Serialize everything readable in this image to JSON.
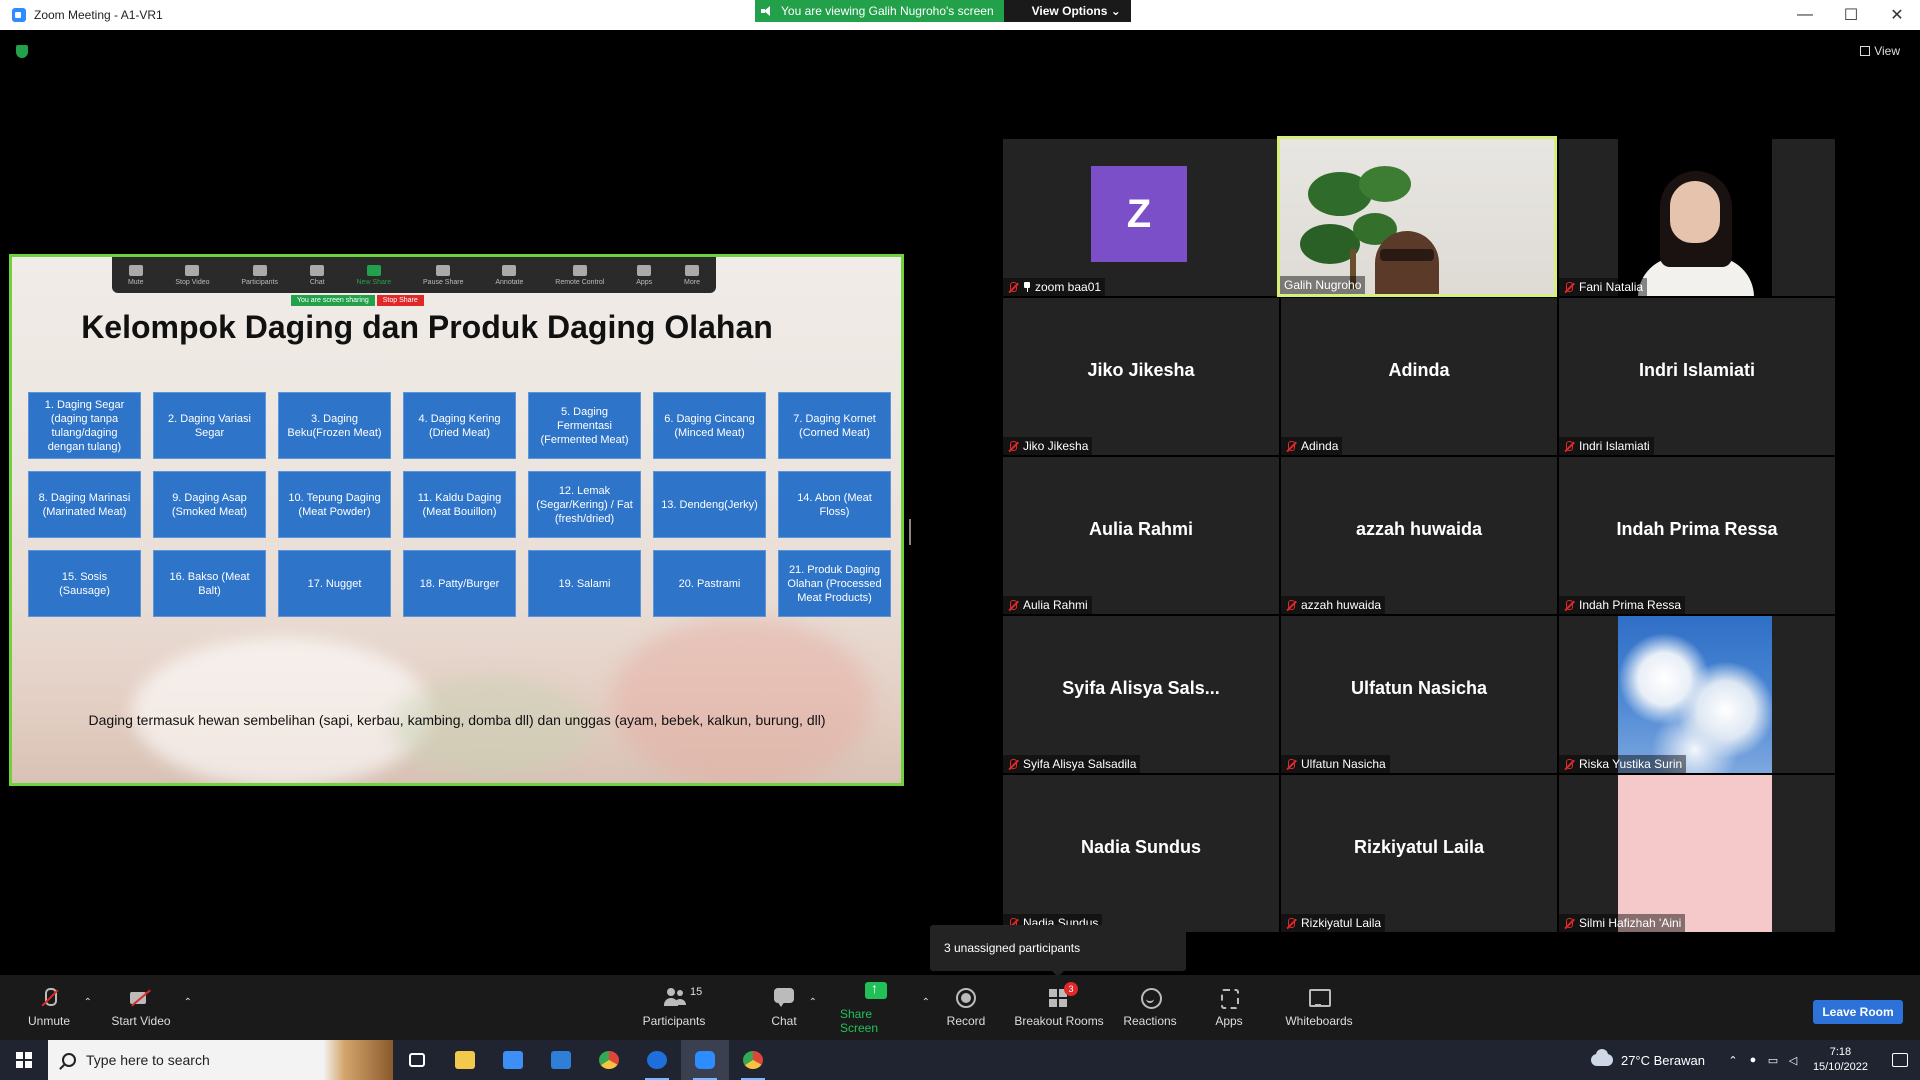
{
  "window": {
    "title": "Zoom Meeting - A1-VR1",
    "controls": {
      "minimize": "—",
      "maximize": "☐",
      "close": "✕"
    }
  },
  "banner": {
    "viewing_text": "You are viewing Galih Nugroho's screen",
    "view_options": "View Options ⌄"
  },
  "top_right": {
    "view_label": "View"
  },
  "shared_screen": {
    "mini_toolbar": [
      {
        "label": "Mute"
      },
      {
        "label": "Stop Video"
      },
      {
        "label": "Participants"
      },
      {
        "label": "Chat"
      },
      {
        "label": "New Share"
      },
      {
        "label": "Pause Share"
      },
      {
        "label": "Annotate"
      },
      {
        "label": "Remote Control"
      },
      {
        "label": "Apps"
      },
      {
        "label": "More"
      }
    ],
    "sharing_status": "You are screen sharing",
    "stop_share": "Stop Share",
    "slide": {
      "title": "Kelompok Daging dan Produk Daging Olahan",
      "items": [
        "1. Daging Segar (daging tanpa tulang/daging dengan tulang)",
        "2. Daging Variasi Segar",
        "3. Daging Beku(Frozen Meat)",
        "4. Daging Kering (Dried Meat)",
        "5. Daging Fermentasi (Fermented Meat)",
        "6. Daging Cincang (Minced Meat)",
        "7. Daging Kornet (Corned Meat)",
        "8. Daging Marinasi (Marinated Meat)",
        "9. Daging Asap (Smoked Meat)",
        "10. Tepung Daging (Meat Powder)",
        "11. Kaldu Daging (Meat Bouillon)",
        "12. Lemak (Segar/Kering) / Fat (fresh/dried)",
        "13. Dendeng(Jerky)",
        "14. Abon (Meat Floss)",
        "15. Sosis (Sausage)",
        "16. Bakso (Meat Balt)",
        "17. Nugget",
        "18. Patty/Burger",
        "19. Salami",
        "20. Pastrami",
        "21. Produk Daging Olahan (Processed Meat Products)"
      ],
      "footer": "Daging termasuk hewan sembelihan (sapi, kerbau, kambing, domba dll) dan unggas (ayam, bebek, kalkun, burung, dll)"
    }
  },
  "participants": [
    {
      "name": "zoom baa01",
      "avatar_letter": "Z",
      "kind": "avatar"
    },
    {
      "name": "Galih Nugroho",
      "kind": "video"
    },
    {
      "name": "Fani Natalia",
      "kind": "video"
    },
    {
      "name": "Jiko Jikesha",
      "display": "Jiko Jikesha"
    },
    {
      "name": "Adinda",
      "display": "Adinda"
    },
    {
      "name": "Indri Islamiati",
      "display": "Indri Islamiati"
    },
    {
      "name": "Aulia Rahmi",
      "display": "Aulia Rahmi"
    },
    {
      "name": "azzah huwaida",
      "display": "azzah huwaida"
    },
    {
      "name": "Indah Prima Ressa",
      "display": "Indah Prima Ressa"
    },
    {
      "name": "Syifa Alisya Salsadila",
      "display": "Syifa  Alisya  Sals..."
    },
    {
      "name": "Ulfatun Nasicha",
      "display": "Ulfatun Nasicha"
    },
    {
      "name": "Riska Yustika Surin",
      "kind": "video"
    },
    {
      "name": "Nadia Sundus",
      "display": "Nadia Sundus"
    },
    {
      "name": "Rizkiyatul Laila",
      "display": "Rizkiyatul Laila"
    },
    {
      "name": "Silmi Hafizhah 'Aini",
      "kind": "video"
    }
  ],
  "unassigned_popup": "3 unassigned participants",
  "toolbar": {
    "unmute": "Unmute",
    "start_video": "Start Video",
    "participants": "Participants",
    "participants_count": "15",
    "chat": "Chat",
    "share_screen": "Share Screen",
    "record": "Record",
    "breakout_rooms": "Breakout Rooms",
    "breakout_badge": "3",
    "reactions": "Reactions",
    "apps": "Apps",
    "whiteboards": "Whiteboards",
    "leave": "Leave Room"
  },
  "taskbar": {
    "search_placeholder": "Type here to search",
    "weather": "27°C  Berawan",
    "time": "7:18",
    "date": "15/10/2022"
  },
  "colors": {
    "share_border": "#6fd13b",
    "active_speaker": "#d7ef7c",
    "slide_box": "#2e74c8",
    "leave_button": "#2d72d9",
    "banner_green": "#23a14a"
  }
}
